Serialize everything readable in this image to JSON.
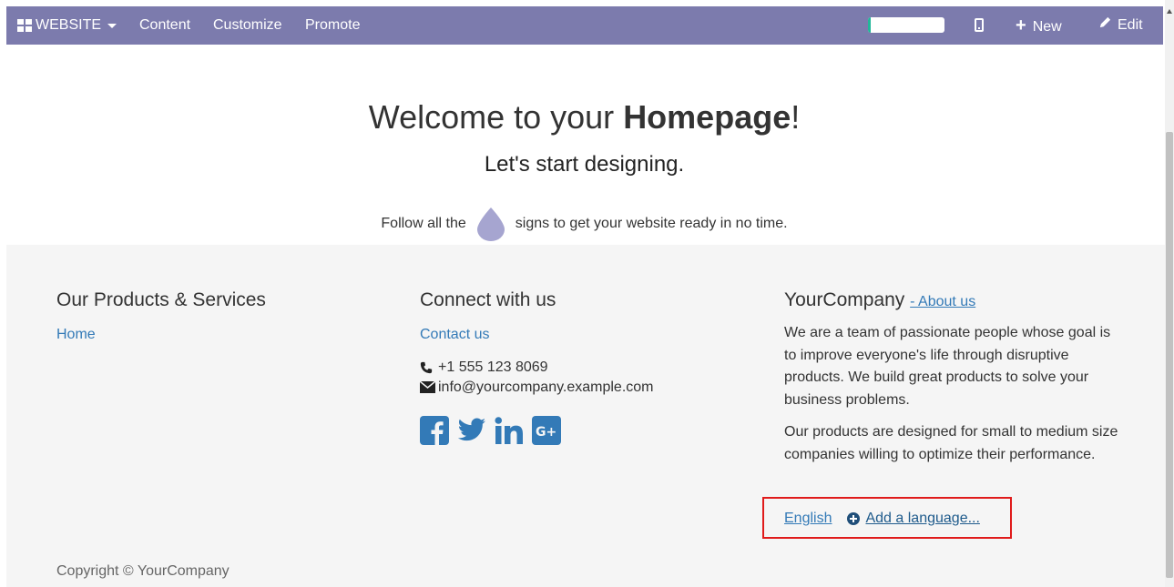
{
  "topbar": {
    "brand_label": "WEBSITE",
    "menu": [
      "Content",
      "Customize",
      "Promote"
    ],
    "progress_fraction": 0.04,
    "new_label": "New",
    "edit_label": "Edit"
  },
  "hero": {
    "title_pre": "Welcome to your ",
    "title_bold": "Homepage",
    "title_post": "!",
    "subtitle": "Let's start designing.",
    "follow_pre": "Follow all the",
    "follow_post": "signs to get your website ready in no time."
  },
  "footer": {
    "col1": {
      "heading": "Our Products & Services",
      "links": [
        "Home"
      ]
    },
    "col2": {
      "heading": "Connect with us",
      "contact_link": "Contact us",
      "phone": "+1 555 123 8069",
      "email": "info@yourcompany.example.com",
      "social_icons": [
        "facebook-icon",
        "twitter-icon",
        "linkedin-icon",
        "google-plus-icon"
      ]
    },
    "col3": {
      "heading": "YourCompany",
      "about_link": "- About us",
      "desc1": "We are a team of passionate people whose goal is to improve everyone's life through disruptive products. We build great products to solve your business problems.",
      "desc2": "Our products are designed for small to medium size companies willing to optimize their performance."
    },
    "language": {
      "current": "English",
      "add_label": "Add a language..."
    },
    "copyright": "Copyright © YourCompany"
  },
  "colors": {
    "topbar": "#7c7bad",
    "link": "#337ab7",
    "highlight_box": "#e01b1b",
    "footer_bg": "#f5f5f5",
    "progress_fill": "#21b799",
    "social": "#337ab7"
  }
}
